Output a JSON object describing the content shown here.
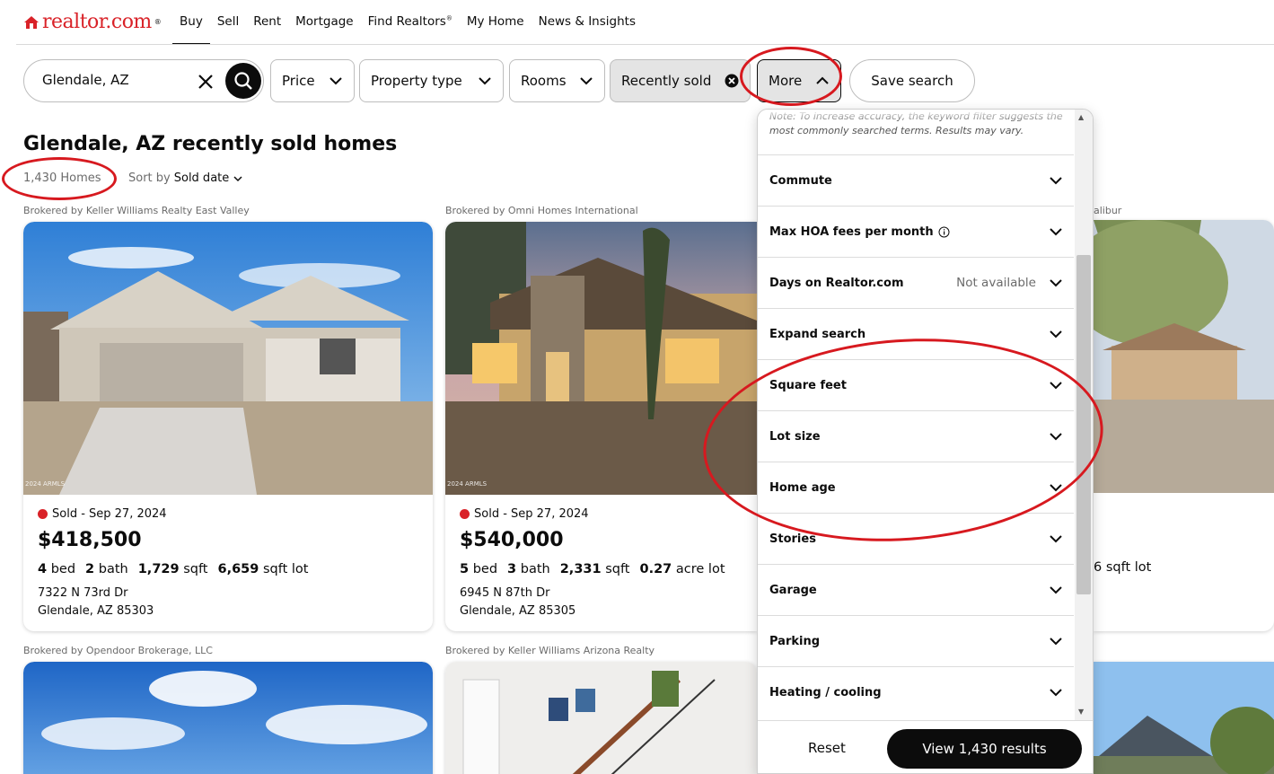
{
  "brand": {
    "logo_text": "realtor.com",
    "trademark": "®"
  },
  "nav": {
    "items": [
      {
        "label": "Buy",
        "active": true
      },
      {
        "label": "Sell"
      },
      {
        "label": "Rent"
      },
      {
        "label": "Mortgage"
      },
      {
        "label": "Find Realtors",
        "superscript": "®"
      },
      {
        "label": "My Home"
      },
      {
        "label": "News & Insights"
      }
    ]
  },
  "search": {
    "value": "Glendale, AZ"
  },
  "filters": {
    "price": "Price",
    "property_type": "Property type",
    "rooms": "Rooms",
    "recently_sold": "Recently sold",
    "more": "More",
    "save_search": "Save search"
  },
  "results": {
    "title": "Glendale, AZ recently sold homes",
    "count": "1,430 Homes",
    "sort_prefix": "Sort by",
    "sort_value": "Sold date"
  },
  "listings": [
    {
      "broker": "Brokered by Keller Williams Realty East Valley",
      "status": "Sold - Sep 27, 2024",
      "price": "$418,500",
      "beds": "4",
      "beds_unit": "bed",
      "baths": "2",
      "baths_unit": "bath",
      "sqft": "1,729",
      "sqft_unit": "sqft",
      "lot": "6,659",
      "lot_unit": "sqft lot",
      "address1": "7322 N 73rd Dr",
      "address2": "Glendale, AZ 85303",
      "watermark": "2024 ARMLS"
    },
    {
      "broker": "Brokered by Omni Homes International",
      "status": "Sold - Sep 27, 2024",
      "price": "$540,000",
      "beds": "5",
      "beds_unit": "bed",
      "baths": "3",
      "baths_unit": "bath",
      "sqft": "2,331",
      "sqft_unit": "sqft",
      "lot": "0.27",
      "lot_unit": "acre lot",
      "address1": "6945 N 87th Dr",
      "address2": "Glendale, AZ 85305",
      "watermark": "2024 ARMLS"
    },
    {
      "broker_partial": "alibur",
      "lot_partial": "6 sqft lot"
    },
    {
      "broker": "Brokered by Opendoor Brokerage, LLC"
    },
    {
      "broker": "Brokered by Keller Williams Arizona Realty"
    }
  ],
  "more_panel": {
    "note": "Note: To increase accuracy, the keyword filter suggests the most commonly searched terms. Results may vary.",
    "rows": [
      {
        "label": "Commute"
      },
      {
        "label": "Max HOA fees per month",
        "info_icon": true
      },
      {
        "label": "Days on Realtor.com",
        "sub": "Not available"
      },
      {
        "label": "Expand search"
      },
      {
        "label": "Square feet"
      },
      {
        "label": "Lot size"
      },
      {
        "label": "Home age"
      },
      {
        "label": "Stories"
      },
      {
        "label": "Garage"
      },
      {
        "label": "Parking"
      },
      {
        "label": "Heating / cooling"
      }
    ],
    "reset": "Reset",
    "view_results": "View 1,430 results"
  },
  "colors": {
    "brand_red": "#d92228",
    "dark": "#0c0c0c",
    "annotation": "#d7191f"
  }
}
